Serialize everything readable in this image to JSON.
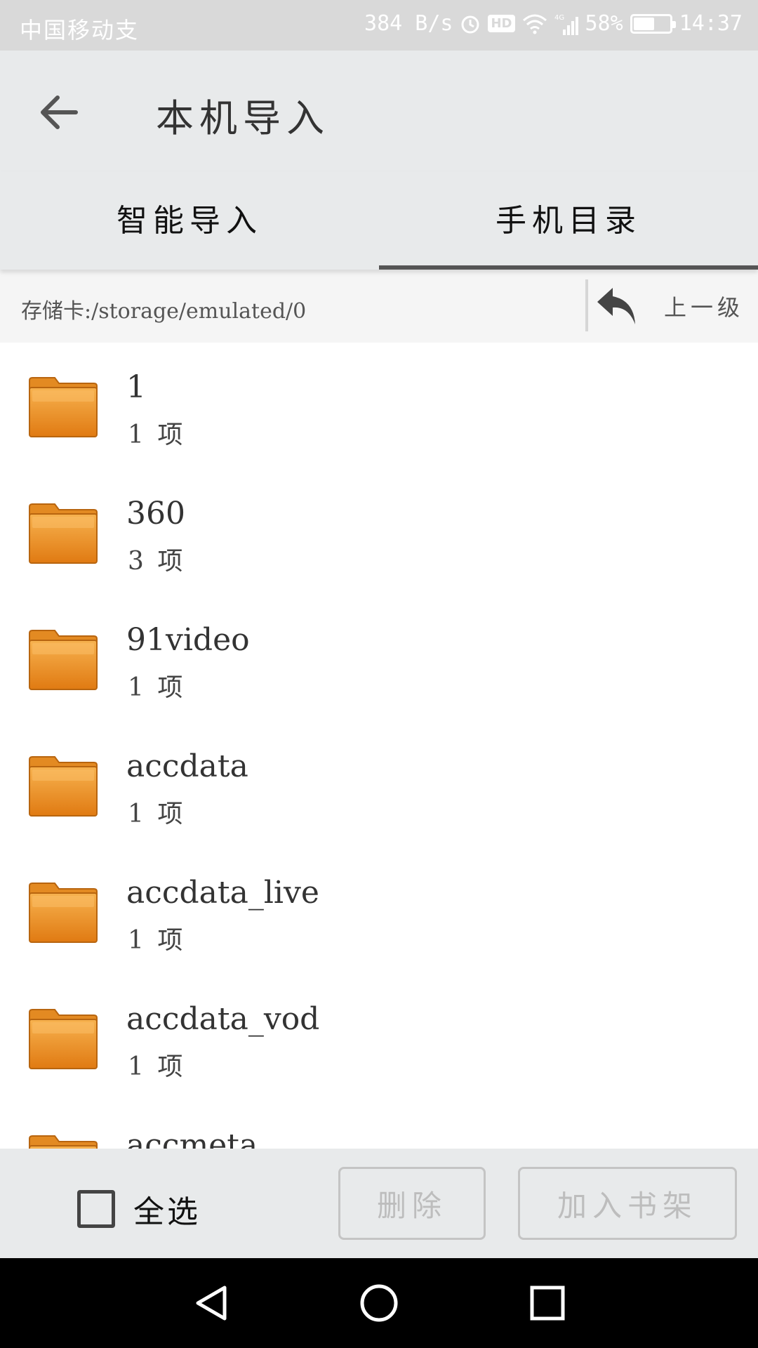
{
  "status_bar": {
    "carrier": "中国移动支",
    "net_speed": "384 B/s",
    "hd_label": "HD",
    "network_label": "4G",
    "battery_percent": "58%",
    "battery_level": 0.58,
    "time": "14:37"
  },
  "app_bar": {
    "title": "本机导入"
  },
  "tabs": [
    {
      "label": "智能导入",
      "active": false
    },
    {
      "label": "手机目录",
      "active": true
    }
  ],
  "path_bar": {
    "path": "存储卡:/storage/emulated/0",
    "up_label": "上一级"
  },
  "files": [
    {
      "name": "1",
      "count": "1 项"
    },
    {
      "name": "360",
      "count": "3 项"
    },
    {
      "name": "91video",
      "count": "1 项"
    },
    {
      "name": "accdata",
      "count": "1 项"
    },
    {
      "name": "accdata_live",
      "count": "1 项"
    },
    {
      "name": "accdata_vod",
      "count": "1 项"
    },
    {
      "name": "accmeta",
      "count": ""
    }
  ],
  "action_bar": {
    "select_all_label": "全选",
    "delete_label": "删除",
    "add_to_shelf_label": "加入书架"
  },
  "colors": {
    "folder_top": "#f5a541",
    "folder_bottom": "#e0801a",
    "folder_edge": "#b8650f",
    "appbar_bg": "#e8eaeb",
    "status_bg": "#d9d9d9"
  }
}
